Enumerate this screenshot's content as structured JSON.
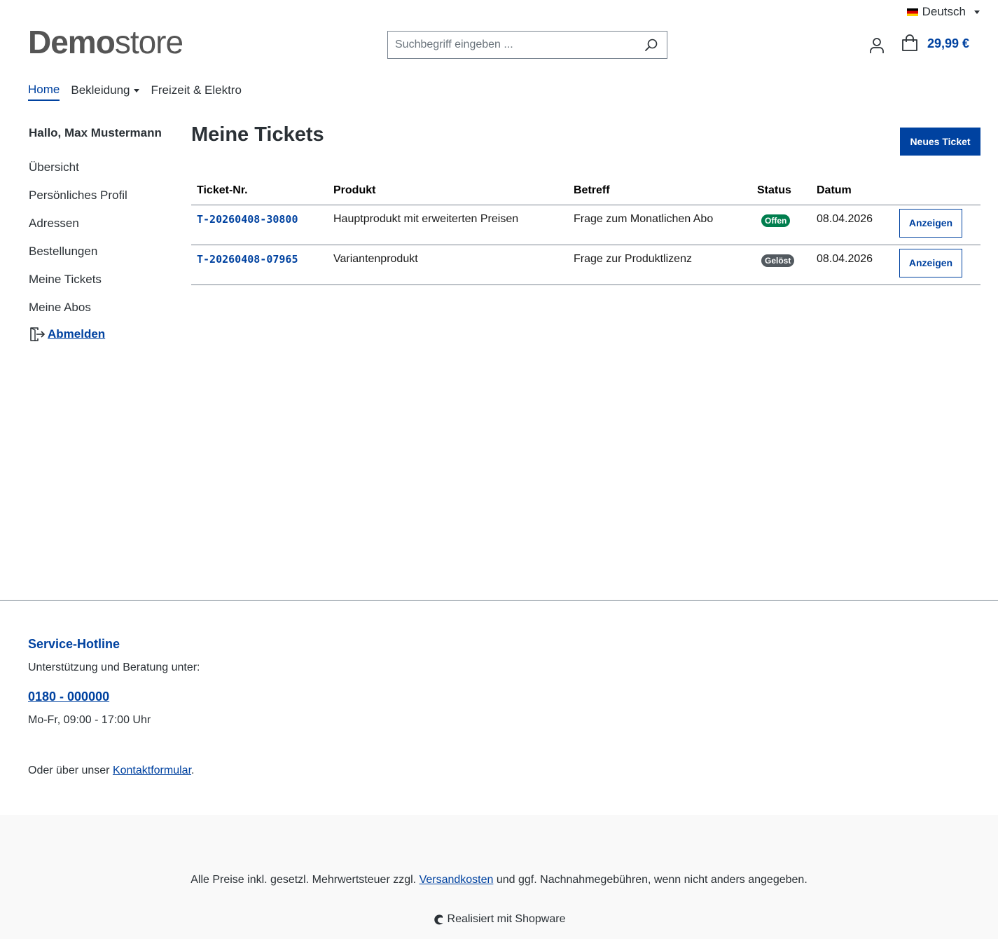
{
  "language": {
    "selected": "Deutsch"
  },
  "header": {
    "logo_bold": "Demo",
    "logo_light": "store",
    "search_placeholder": "Suchbegriff eingeben ...",
    "cart_total": "29,99 €"
  },
  "nav": {
    "items": [
      {
        "label": "Home",
        "active": true
      },
      {
        "label": "Bekleidung",
        "dropdown": true
      },
      {
        "label": "Freizeit & Elektro"
      }
    ]
  },
  "sidebar": {
    "greeting": "Hallo, Max Mustermann",
    "links": [
      "Übersicht",
      "Persönliches Profil",
      "Adressen",
      "Bestellungen",
      "Meine Tickets",
      "Meine Abos"
    ],
    "logout": "Abmelden"
  },
  "main": {
    "title": "Meine Tickets",
    "new_ticket_button": "Neues Ticket",
    "columns": [
      "Ticket-Nr.",
      "Produkt",
      "Betreff",
      "Status",
      "Datum"
    ],
    "tickets": [
      {
        "id": "T-20260408-30800",
        "product": "Hauptprodukt mit erweiterten Preisen",
        "subject": "Frage zum Monatlichen Abo",
        "status": "Offen",
        "date": "08.04.2026",
        "action": "Anzeigen"
      },
      {
        "id": "T-20260408-07965",
        "product": "Variantenprodukt",
        "subject": "Frage zur Produktlizenz",
        "status": "Gelöst",
        "date": "08.04.2026",
        "action": "Anzeigen"
      }
    ]
  },
  "footer": {
    "hotline_title": "Service-Hotline",
    "hotline_text": "Unterstützung und Beratung unter:",
    "phone": "0180 - 000000",
    "hours": "Mo-Fr, 09:00 - 17:00 Uhr",
    "contact_prefix": "Oder über unser ",
    "contact_link": "Kontaktformular",
    "contact_suffix": ".",
    "vat_prefix": "Alle Preise inkl. gesetzl. Mehrwertsteuer zzgl. ",
    "vat_link": "Versandkosten",
    "vat_suffix": " und ggf. Nachnahmegebühren, wenn nicht anders angegeben.",
    "powered_by": "Realisiert mit Shopware"
  },
  "colors": {
    "brand": "#0042a0",
    "status_open": "#007e4e",
    "status_solved": "#52595f"
  }
}
